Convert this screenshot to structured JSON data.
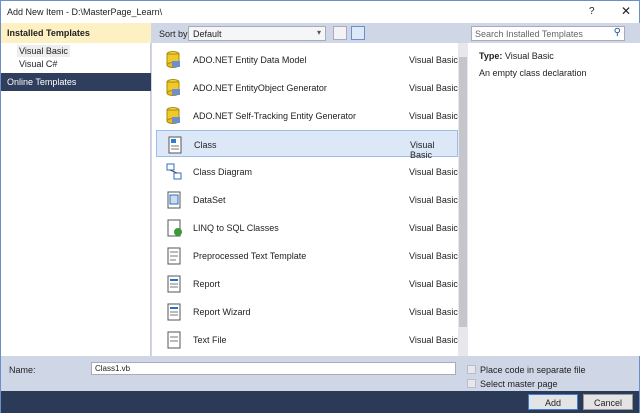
{
  "window": {
    "title": "Add New Item - D:\\MasterPage_Learn\\",
    "help": "?",
    "close": "✕"
  },
  "left": {
    "installed": "Installed Templates",
    "items": [
      "Visual Basic",
      "Visual C#"
    ],
    "online": "Online Templates"
  },
  "toolbar": {
    "sort_label": "Sort by:",
    "sort_value": "Default"
  },
  "templates": [
    {
      "name": "ADO.NET Entity Data Model",
      "lang": "Visual Basic",
      "icon": "database-icon"
    },
    {
      "name": "ADO.NET EntityObject Generator",
      "lang": "Visual Basic",
      "icon": "database-icon"
    },
    {
      "name": "ADO.NET Self-Tracking Entity Generator",
      "lang": "Visual Basic",
      "icon": "database-icon"
    },
    {
      "name": "Class",
      "lang": "Visual Basic",
      "icon": "class-icon",
      "selected": true
    },
    {
      "name": "Class Diagram",
      "lang": "Visual Basic",
      "icon": "diagram-icon"
    },
    {
      "name": "DataSet",
      "lang": "Visual Basic",
      "icon": "dataset-icon"
    },
    {
      "name": "LINQ to SQL Classes",
      "lang": "Visual Basic",
      "icon": "linq-icon"
    },
    {
      "name": "Preprocessed Text Template",
      "lang": "Visual Basic",
      "icon": "text-template-icon"
    },
    {
      "name": "Report",
      "lang": "Visual Basic",
      "icon": "report-icon"
    },
    {
      "name": "Report Wizard",
      "lang": "Visual Basic",
      "icon": "report-icon"
    },
    {
      "name": "Text File",
      "lang": "Visual Basic",
      "icon": "file-icon"
    }
  ],
  "right": {
    "search_placeholder": "Search Installed Templates",
    "type_label": "Type:",
    "type_value": "Visual Basic",
    "description": "An empty class declaration"
  },
  "bottom": {
    "name_label": "Name:",
    "name_value": "Class1.vb",
    "opt1": "Place code in separate file",
    "opt2": "Select master page",
    "add": "Add",
    "cancel": "Cancel"
  },
  "colors": {
    "accent": "#2e3e5c",
    "selection": "#dce8f7",
    "installed_header": "#fdf1c4"
  }
}
